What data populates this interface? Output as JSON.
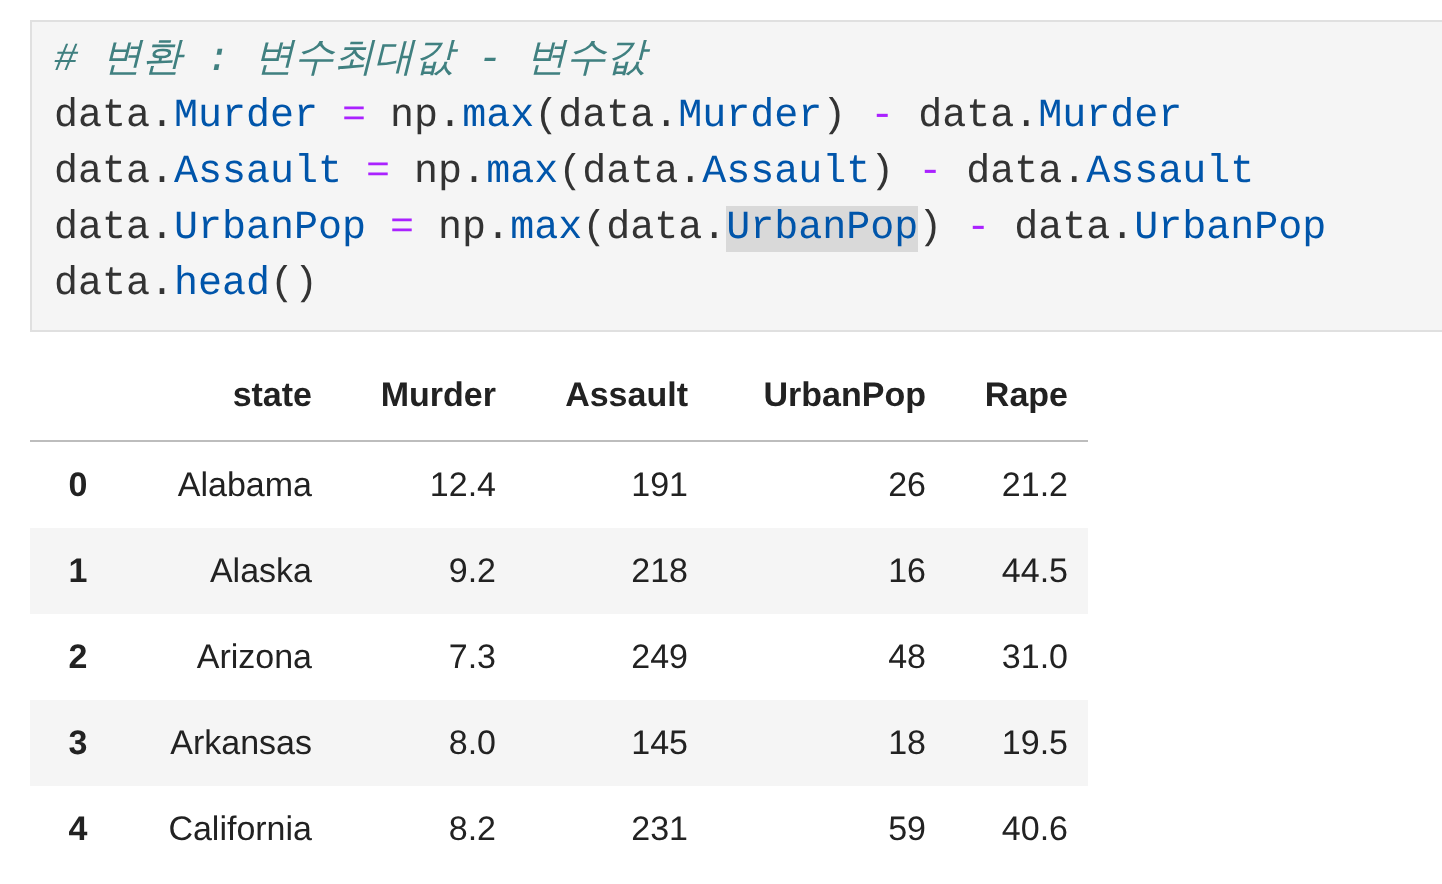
{
  "code_cell": {
    "lines": [
      [
        {
          "text": "# 변환 : 변수최대값 - 변수값",
          "kind": "comment",
          "highlighted": false
        }
      ],
      [
        {
          "text": "data.",
          "kind": "plain",
          "highlighted": false
        },
        {
          "text": "Murder",
          "kind": "attr",
          "highlighted": false
        },
        {
          "text": " = ",
          "kind": "op",
          "highlighted": false
        },
        {
          "text": "np.",
          "kind": "plain",
          "highlighted": false
        },
        {
          "text": "max",
          "kind": "attr",
          "highlighted": false
        },
        {
          "text": "(data.",
          "kind": "plain",
          "highlighted": false
        },
        {
          "text": "Murder",
          "kind": "attr",
          "highlighted": false
        },
        {
          "text": ") ",
          "kind": "plain",
          "highlighted": false
        },
        {
          "text": "-",
          "kind": "op",
          "highlighted": false
        },
        {
          "text": " data.",
          "kind": "plain",
          "highlighted": false
        },
        {
          "text": "Murder",
          "kind": "attr",
          "highlighted": false
        }
      ],
      [
        {
          "text": "data.",
          "kind": "plain",
          "highlighted": false
        },
        {
          "text": "Assault",
          "kind": "attr",
          "highlighted": false
        },
        {
          "text": " = ",
          "kind": "op",
          "highlighted": false
        },
        {
          "text": "np.",
          "kind": "plain",
          "highlighted": false
        },
        {
          "text": "max",
          "kind": "attr",
          "highlighted": false
        },
        {
          "text": "(data.",
          "kind": "plain",
          "highlighted": false
        },
        {
          "text": "Assault",
          "kind": "attr",
          "highlighted": false
        },
        {
          "text": ") ",
          "kind": "plain",
          "highlighted": false
        },
        {
          "text": "-",
          "kind": "op",
          "highlighted": false
        },
        {
          "text": " data.",
          "kind": "plain",
          "highlighted": false
        },
        {
          "text": "Assault",
          "kind": "attr",
          "highlighted": false
        }
      ],
      [
        {
          "text": "data.",
          "kind": "plain",
          "highlighted": false
        },
        {
          "text": "UrbanPop",
          "kind": "attr",
          "highlighted": false
        },
        {
          "text": " = ",
          "kind": "op",
          "highlighted": false
        },
        {
          "text": "np.",
          "kind": "plain",
          "highlighted": false
        },
        {
          "text": "max",
          "kind": "attr",
          "highlighted": false
        },
        {
          "text": "(data.",
          "kind": "plain",
          "highlighted": false
        },
        {
          "text": "UrbanPop",
          "kind": "attr",
          "highlighted": true
        },
        {
          "text": ") ",
          "kind": "plain",
          "highlighted": false
        },
        {
          "text": "-",
          "kind": "op",
          "highlighted": false
        },
        {
          "text": " data.",
          "kind": "plain",
          "highlighted": false
        },
        {
          "text": "UrbanPop",
          "kind": "attr",
          "highlighted": false
        }
      ],
      [
        {
          "text": "data.",
          "kind": "plain",
          "highlighted": false
        },
        {
          "text": "head",
          "kind": "attr",
          "highlighted": false
        },
        {
          "text": "()",
          "kind": "plain",
          "highlighted": false
        }
      ]
    ]
  },
  "table": {
    "columns": [
      "state",
      "Murder",
      "Assault",
      "UrbanPop",
      "Rape"
    ],
    "rows": [
      {
        "index": "0",
        "cells": [
          "Alabama",
          "12.4",
          "191",
          "26",
          "21.2"
        ]
      },
      {
        "index": "1",
        "cells": [
          "Alaska",
          "9.2",
          "218",
          "16",
          "44.5"
        ]
      },
      {
        "index": "2",
        "cells": [
          "Arizona",
          "7.3",
          "249",
          "48",
          "31.0"
        ]
      },
      {
        "index": "3",
        "cells": [
          "Arkansas",
          "8.0",
          "145",
          "18",
          "19.5"
        ]
      },
      {
        "index": "4",
        "cells": [
          "California",
          "8.2",
          "231",
          "59",
          "40.6"
        ]
      }
    ]
  }
}
